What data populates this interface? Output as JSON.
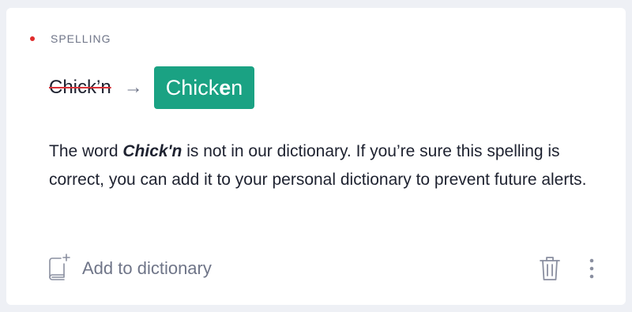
{
  "card": {
    "category": "SPELLING",
    "category_color": "#e02b2b",
    "original_word": "Chick’n",
    "arrow_icon": "arrow-right-icon",
    "suggestion_prefix": "Chick",
    "suggestion_bold": "e",
    "suggestion_suffix": "n",
    "suggestion_color": "#1aa283",
    "description": {
      "before": "The word ",
      "word": "Chick'n",
      "after": " is not in our dictionary. If you’re sure this spelling is correct, you can add it to your personal dictionary to prevent future alerts."
    },
    "add_button_label": "Add to dictionary",
    "add_icon": "add-to-dictionary-book-icon",
    "delete_icon": "trash-icon",
    "more_icon": "more-vertical-icon"
  }
}
